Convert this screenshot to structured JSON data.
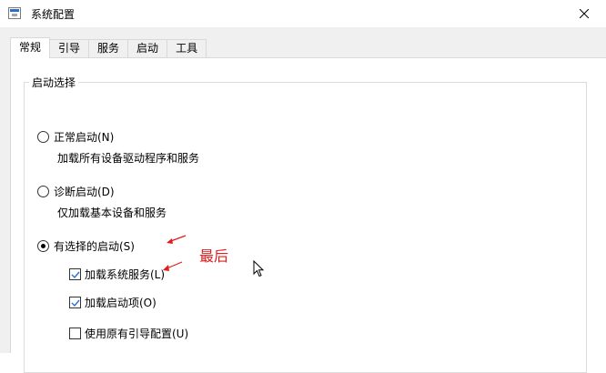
{
  "window": {
    "title": "系统配置",
    "close_icon": "close-icon",
    "app_icon": "msconfig-icon"
  },
  "tabs": [
    {
      "label": "常规",
      "active": true
    },
    {
      "label": "引导",
      "active": false
    },
    {
      "label": "服务",
      "active": false
    },
    {
      "label": "启动",
      "active": false
    },
    {
      "label": "工具",
      "active": false
    }
  ],
  "startup_selection": {
    "group_title": "启动选择",
    "options": [
      {
        "label": "正常启动(N)",
        "description": "加载所有设备驱动程序和服务",
        "checked": false
      },
      {
        "label": "诊断启动(D)",
        "description": "仅加载基本设备和服务",
        "checked": false
      },
      {
        "label": "有选择的启动(S)",
        "checked": true
      }
    ],
    "selective": [
      {
        "label": "加载系统服务(L)",
        "checked": true
      },
      {
        "label": "加载启动项(O)",
        "checked": true
      },
      {
        "label": "使用原有引导配置(U)",
        "checked": false
      }
    ]
  },
  "annotation": {
    "text": "最后",
    "color": "#e21b1b"
  },
  "colors": {
    "accent": "#2b6fd6",
    "annotation": "#e21b1b",
    "panel_bg": "#ffffff",
    "chrome_bg": "#f0f0f0"
  }
}
